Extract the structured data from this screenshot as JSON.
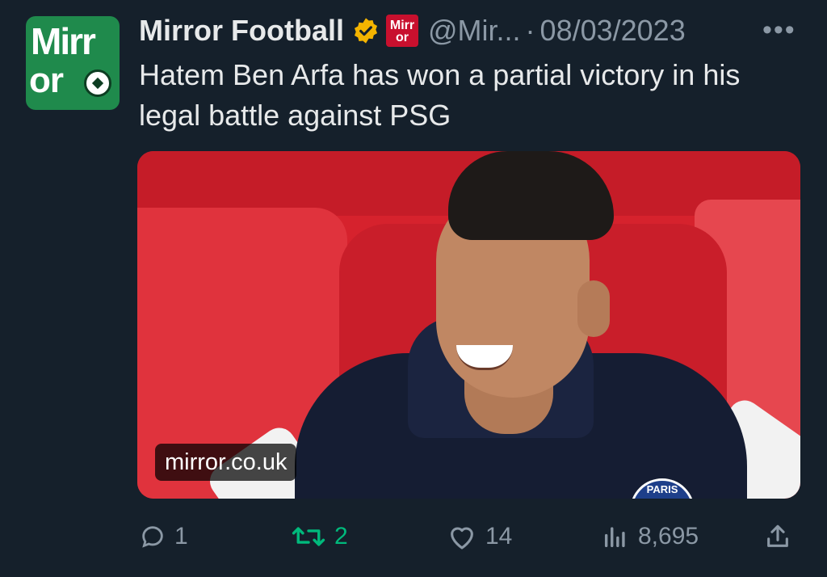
{
  "author": {
    "name": "Mirror Football",
    "handle": "@Mir...",
    "separator": "·",
    "date": "08/03/2023",
    "avatar_logo_top": "Mirr",
    "avatar_logo_bottom": "or",
    "badge_logo_top": "Mirr",
    "badge_logo_bottom": "or"
  },
  "menu": {
    "more": "•••"
  },
  "tweet": {
    "text": "Hatem Ben Arfa has won a partial victory in his legal battle against PSG"
  },
  "media": {
    "source_label": "mirror.co.uk",
    "crest_text": "PARIS"
  },
  "actions": {
    "replies": "1",
    "retweets": "2",
    "likes": "14",
    "views": "8,695"
  },
  "colors": {
    "background": "#15202b",
    "text": "#e7e9ea",
    "muted": "#8b98a5",
    "retweet": "#00ba7c",
    "brand_green": "#1f8a4c",
    "brand_red": "#c8102e",
    "verified_gold": "#f4b400"
  }
}
